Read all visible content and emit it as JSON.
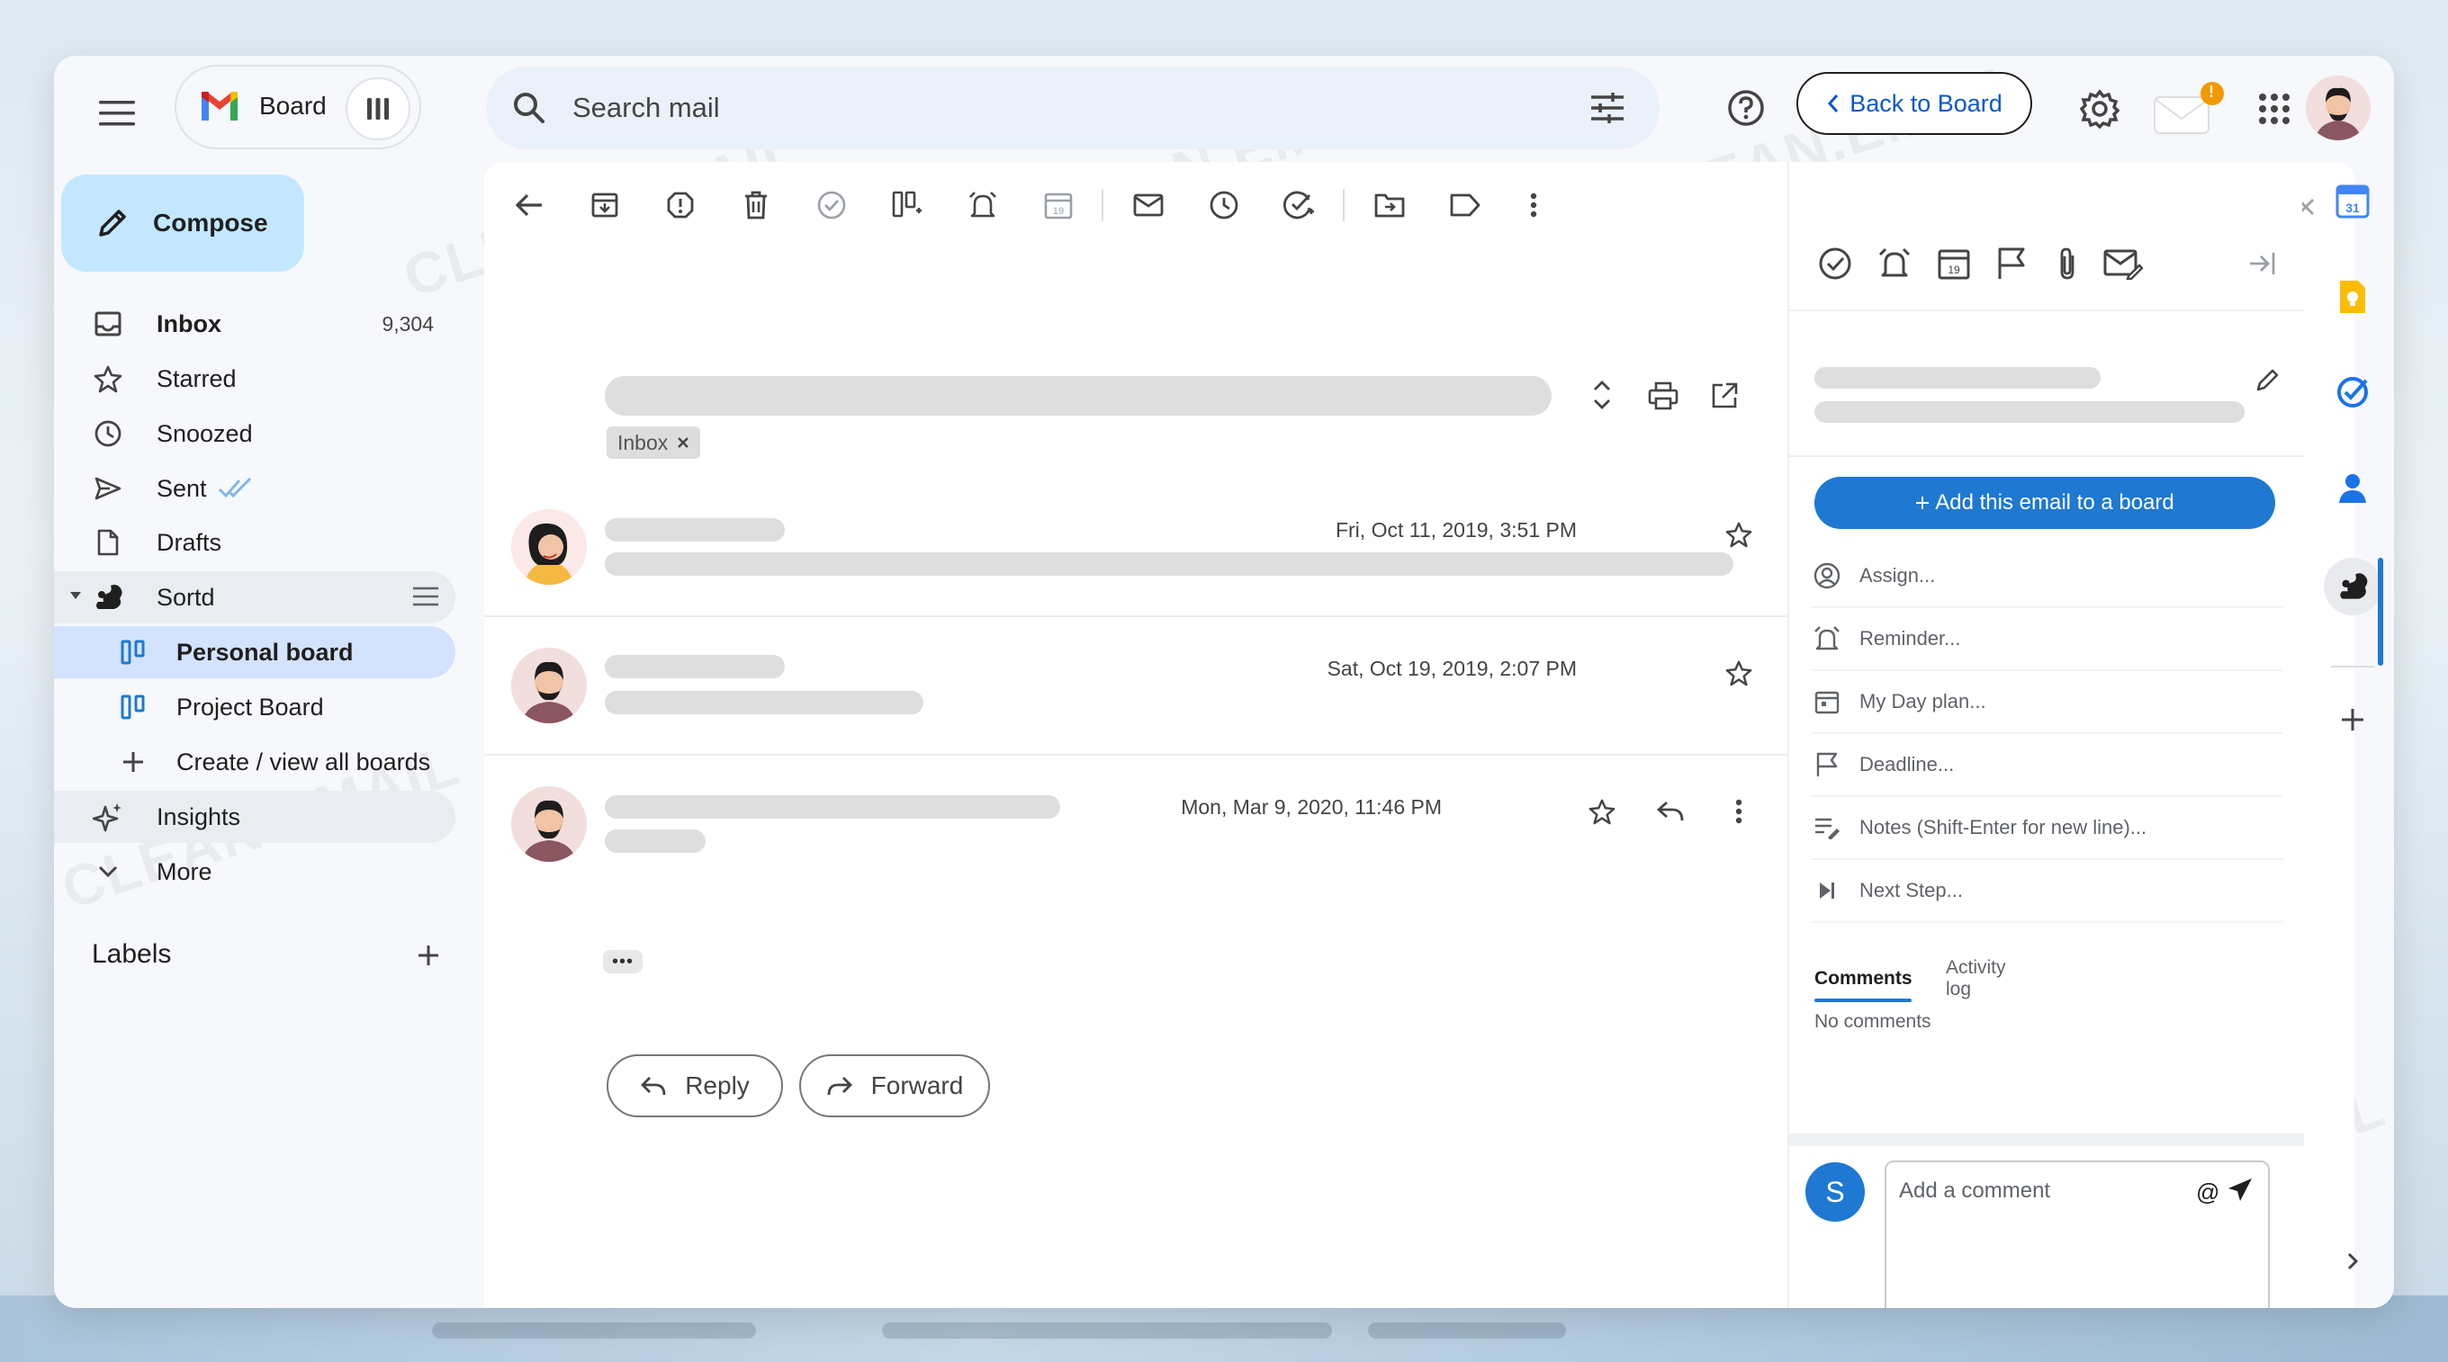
{
  "app": {
    "board_label": "Board",
    "search": {
      "placeholder": "Search mail"
    },
    "back_to_board": "Back to Board",
    "notification_count": "!"
  },
  "nav": {
    "compose": "Compose",
    "items": [
      {
        "label": "Inbox",
        "count": "9,304"
      },
      {
        "label": "Starred"
      },
      {
        "label": "Snoozed"
      },
      {
        "label": "Sent"
      },
      {
        "label": "Drafts"
      },
      {
        "label": "Sortd"
      },
      {
        "label": "Personal board"
      },
      {
        "label": "Project Board"
      },
      {
        "label": "Create / view all boards"
      },
      {
        "label": "Insights"
      },
      {
        "label": "More"
      }
    ],
    "labels_heading": "Labels"
  },
  "thread": {
    "tag": "Inbox",
    "messages": [
      {
        "date": "Fri, Oct 11, 2019, 3:51 PM"
      },
      {
        "date": "Sat, Oct 19, 2019, 2:07 PM"
      },
      {
        "date": "Mon, Mar 9, 2020, 11:46 PM"
      }
    ],
    "more_dots": "•••",
    "reply": "Reply",
    "forward": "Forward"
  },
  "sidebar": {
    "add_to_board": "Add this email to a board",
    "props": [
      "Assign...",
      "Reminder...",
      "My Day plan...",
      "Deadline...",
      "Notes (Shift-Enter for new line)...",
      "Next Step..."
    ],
    "tabs": {
      "comments": "Comments",
      "activity": "Activity log"
    },
    "no_comments": "No comments",
    "avatar_letter": "S",
    "comment_placeholder": "Add a comment",
    "at": "@"
  },
  "watermark": "CLEAN.EMAIL",
  "colors": {
    "accent": "#1f78d1",
    "compose_bg": "#c2e7ff",
    "selected_bg": "#d3e3fd",
    "link": "#0b57d0"
  }
}
